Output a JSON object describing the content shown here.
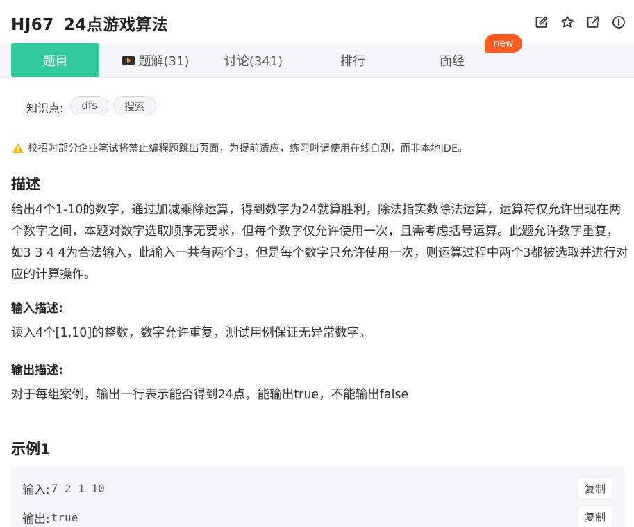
{
  "problem": {
    "id": "HJ67",
    "name": "24点游戏算法"
  },
  "header_icons": [
    "edit-icon",
    "star-icon",
    "external-link-icon",
    "info-icon"
  ],
  "tabs": [
    {
      "label": "题目",
      "active": true
    },
    {
      "label": "题解(31)",
      "icon": "video-play-icon"
    },
    {
      "label": "讨论(341)"
    },
    {
      "label": "排行"
    },
    {
      "label": "面经"
    }
  ],
  "new_badge": "new",
  "knowledge": {
    "label": "知识点:",
    "tags": [
      "dfs",
      "搜索"
    ]
  },
  "warning": "校招时部分企业笔试将禁止编程题跳出页面，为提前适应，练习时请使用在线自测，而非本地IDE。",
  "description": {
    "title": "描述",
    "text": "给出4个1-10的数字，通过加减乘除运算，得到数字为24就算胜利，除法指实数除法运算，运算符仅允许出现在两个数字之间，本题对数字选取顺序无要求，但每个数字仅允许使用一次，且需考虑括号运算。此题允许数字重复，如3 3 4 4为合法输入，此输入一共有两个3，但是每个数字只允许使用一次，则运算过程中两个3都被选取并进行对应的计算操作。"
  },
  "input_desc": {
    "title": "输入描述:",
    "text": "读入4个[1,10]的整数，数字允许重复，测试用例保证无异常数字。"
  },
  "output_desc": {
    "title": "输出描述:",
    "text": "对于每组案例，输出一行表示能否得到24点，能输出true，不能输出false"
  },
  "example": {
    "title": "示例1",
    "input_label": "输入:",
    "input_value": "7 2 1 10",
    "output_label": "输出:",
    "output_value": "true",
    "copy_label": "复制"
  },
  "colors": {
    "accent": "#32ca99",
    "badge": "#ff5a1f",
    "warning": "#f5b400"
  }
}
